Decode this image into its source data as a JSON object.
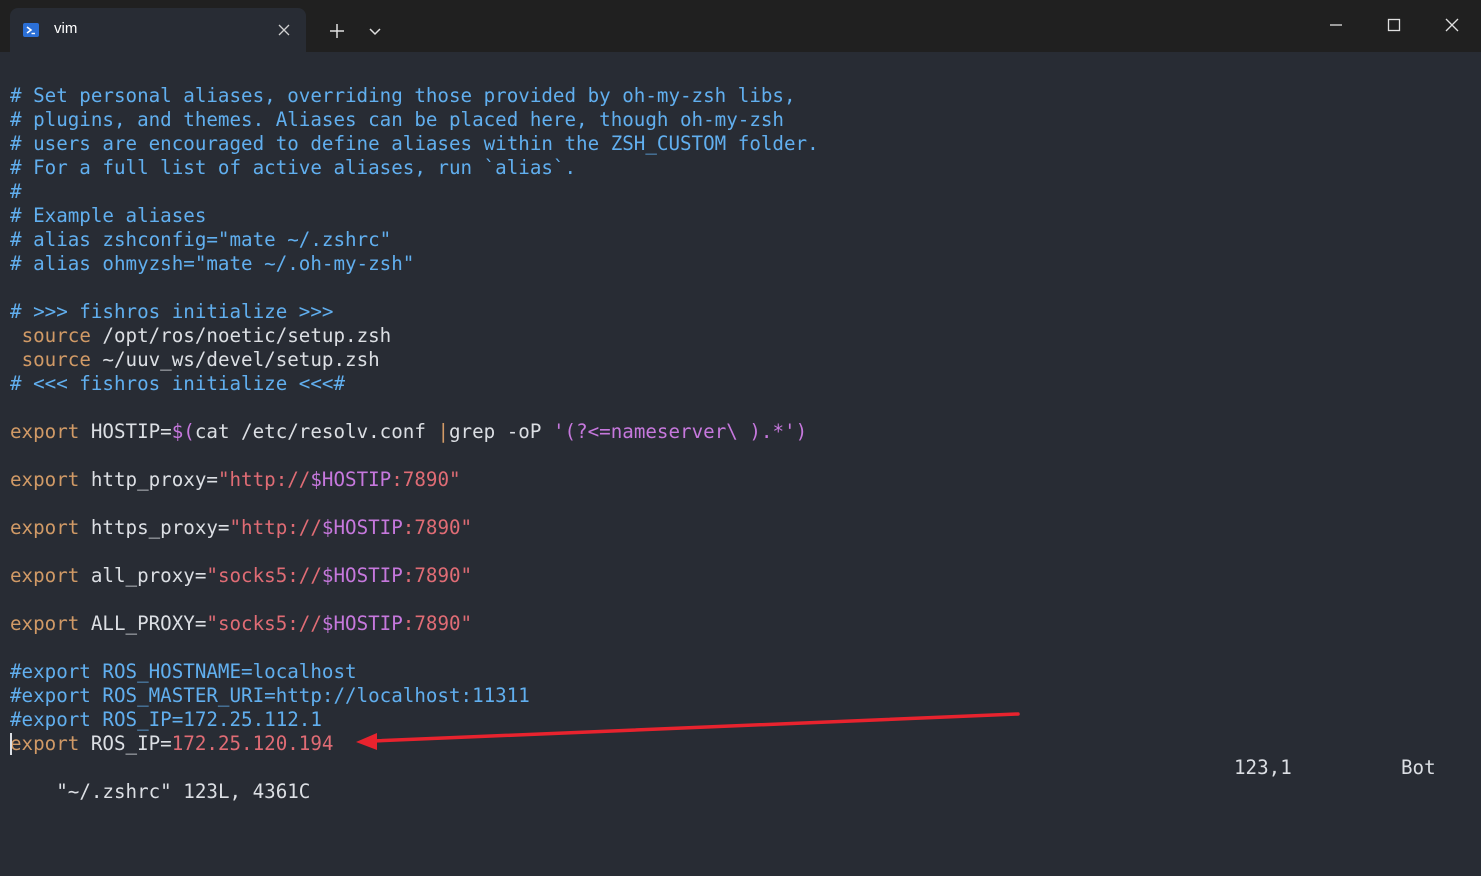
{
  "tab": {
    "title": "vim"
  },
  "lines": [
    {
      "parts": [
        {
          "t": "# Set personal aliases, overriding those provided by oh-my-zsh libs,",
          "k": "c"
        }
      ]
    },
    {
      "parts": [
        {
          "t": "# plugins, and themes. Aliases can be placed here, though oh-my-zsh",
          "k": "c"
        }
      ]
    },
    {
      "parts": [
        {
          "t": "# users are encouraged to define aliases within the ZSH_CUSTOM folder.",
          "k": "c"
        }
      ]
    },
    {
      "parts": [
        {
          "t": "# For a full list of active aliases, run `alias`.",
          "k": "c"
        }
      ]
    },
    {
      "parts": [
        {
          "t": "#",
          "k": "c"
        }
      ]
    },
    {
      "parts": [
        {
          "t": "# Example aliases",
          "k": "c"
        }
      ]
    },
    {
      "parts": [
        {
          "t": "# alias zshconfig=\"mate ~/.zshrc\"",
          "k": "c"
        }
      ]
    },
    {
      "parts": [
        {
          "t": "# alias ohmyzsh=\"mate ~/.oh-my-zsh\"",
          "k": "c"
        }
      ]
    },
    {
      "parts": []
    },
    {
      "parts": [
        {
          "t": "# >>> fishros initialize >>>",
          "k": "c"
        }
      ]
    },
    {
      "parts": [
        {
          "t": " ",
          "k": "p"
        },
        {
          "t": "source",
          "k": "k"
        },
        {
          "t": " /opt/ros/noetic/setup.zsh",
          "k": "p"
        }
      ]
    },
    {
      "parts": [
        {
          "t": " ",
          "k": "p"
        },
        {
          "t": "source",
          "k": "k"
        },
        {
          "t": " ~/uuv_ws/devel/setup.zsh",
          "k": "p"
        }
      ]
    },
    {
      "parts": [
        {
          "t": "# <<< fishros initialize <<<#",
          "k": "c"
        }
      ]
    },
    {
      "parts": []
    },
    {
      "parts": [
        {
          "t": "export",
          "k": "k"
        },
        {
          "t": " HOSTIP=",
          "k": "p"
        },
        {
          "t": "$(",
          "k": "d"
        },
        {
          "t": "cat /etc/resolv.conf ",
          "k": "p"
        },
        {
          "t": "|",
          "k": "k"
        },
        {
          "t": "grep -oP ",
          "k": "p"
        },
        {
          "t": "'(?<=nameserver\\ ).*'",
          "k": "d"
        },
        {
          "t": ")",
          "k": "d"
        }
      ]
    },
    {
      "parts": []
    },
    {
      "parts": [
        {
          "t": "export",
          "k": "k"
        },
        {
          "t": " http_proxy=",
          "k": "p"
        },
        {
          "t": "\"http://",
          "k": "s"
        },
        {
          "t": "$HOSTIP",
          "k": "d"
        },
        {
          "t": ":7890\"",
          "k": "s"
        }
      ]
    },
    {
      "parts": []
    },
    {
      "parts": [
        {
          "t": "export",
          "k": "k"
        },
        {
          "t": " https_proxy=",
          "k": "p"
        },
        {
          "t": "\"http://",
          "k": "s"
        },
        {
          "t": "$HOSTIP",
          "k": "d"
        },
        {
          "t": ":7890\"",
          "k": "s"
        }
      ]
    },
    {
      "parts": []
    },
    {
      "parts": [
        {
          "t": "export",
          "k": "k"
        },
        {
          "t": " all_proxy=",
          "k": "p"
        },
        {
          "t": "\"socks5://",
          "k": "s"
        },
        {
          "t": "$HOSTIP",
          "k": "d"
        },
        {
          "t": ":7890\"",
          "k": "s"
        }
      ]
    },
    {
      "parts": []
    },
    {
      "parts": [
        {
          "t": "export",
          "k": "k"
        },
        {
          "t": " ALL_PROXY=",
          "k": "p"
        },
        {
          "t": "\"socks5://",
          "k": "s"
        },
        {
          "t": "$HOSTIP",
          "k": "d"
        },
        {
          "t": ":7890\"",
          "k": "s"
        }
      ]
    },
    {
      "parts": []
    },
    {
      "parts": [
        {
          "t": "#export ROS_HOSTNAME=localhost",
          "k": "c"
        }
      ]
    },
    {
      "parts": [
        {
          "t": "#export ROS_MASTER_URI=http://localhost:11311",
          "k": "c"
        }
      ]
    },
    {
      "parts": [
        {
          "t": "#export ROS_IP=172.25.112.1",
          "k": "c"
        }
      ]
    },
    {
      "parts": [
        {
          "t": "export",
          "k": "k"
        },
        {
          "t": " ROS_IP=",
          "k": "p"
        },
        {
          "t": "172.25.120.194",
          "k": "s"
        }
      ]
    }
  ],
  "status": {
    "file": "\"~/.zshrc\" 123L, 4361C",
    "position": "123,1",
    "scroll": "Bot"
  },
  "icon_names": [
    "terminal-icon",
    "close-icon",
    "plus-icon",
    "chevron-down-icon",
    "minimize-icon",
    "maximize-icon",
    "window-close-icon"
  ],
  "colors": {
    "background": "#282c34",
    "titlebar": "#202020",
    "comment": "#61afef",
    "keyword": "#d19a66",
    "variable": "#c678dd",
    "string": "#e06c75",
    "text": "#dcdfe4",
    "annotation_arrow": "#e8232e"
  }
}
